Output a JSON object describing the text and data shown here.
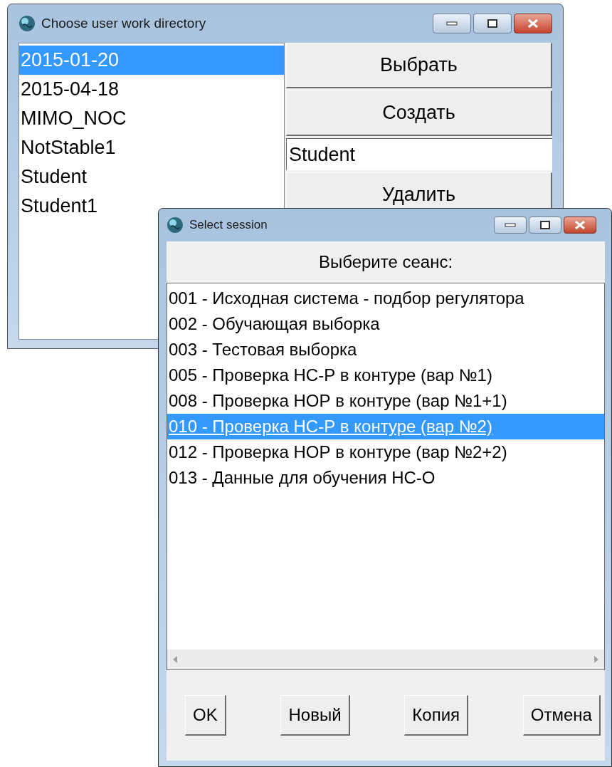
{
  "directory_window": {
    "title": "Choose user work directory",
    "folders": [
      {
        "label": "2015-01-20",
        "selected": true
      },
      {
        "label": "2015-04-18",
        "selected": false
      },
      {
        "label": "MIMO_NOC",
        "selected": false
      },
      {
        "label": "NotStable1",
        "selected": false
      },
      {
        "label": "Student",
        "selected": false
      },
      {
        "label": "Student1",
        "selected": false
      }
    ],
    "select_button": "Выбрать",
    "create_button": "Создать",
    "name_field": {
      "value": "Student"
    },
    "delete_button": "Удалить"
  },
  "session_window": {
    "title": "Select session",
    "prompt": "Выберите сеанс:",
    "sessions": [
      {
        "label": "001 - Исходная система - подбор регулятора",
        "selected": false
      },
      {
        "label": "002 - Обучающая выборка",
        "selected": false
      },
      {
        "label": "003 - Тестовая выборка",
        "selected": false
      },
      {
        "label": "005 - Проверка НС-Р в контуре (вар №1)",
        "selected": false
      },
      {
        "label": "008 - Проверка НОР в контуре (вар №1+1)",
        "selected": false
      },
      {
        "label": "010 - Проверка НС-Р в контуре (вар №2)",
        "selected": true
      },
      {
        "label": "012 - Проверка НОР в контуре (вар №2+2)",
        "selected": false
      },
      {
        "label": "013 - Данные для обучения НС-О",
        "selected": false
      }
    ],
    "buttons": [
      "OK",
      "Новый",
      "Копия",
      "Отмена"
    ]
  }
}
